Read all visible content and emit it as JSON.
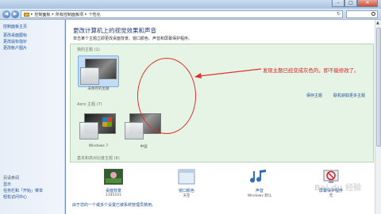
{
  "window": {
    "minimize_glyph": "–",
    "maximize_glyph": "□",
    "close_glyph": "✕"
  },
  "address": {
    "back_glyph": "◀",
    "forward_glyph": "▶",
    "separator": "▸",
    "crumbs": [
      "控制面板",
      "所有控制面板项",
      "个性化"
    ],
    "refresh_glyph": "↻",
    "search_placeholder": ""
  },
  "sidebar": {
    "home": "控制面板主页",
    "links": [
      "更改桌面图标",
      "更改鼠标指针",
      "更改帐户图片"
    ],
    "see_also_title": "另请参阅",
    "see_also": [
      "显示",
      "任务栏和「开始」菜单",
      "轻松访问中心"
    ]
  },
  "main": {
    "title": "更改计算机上的视觉效果和声音",
    "description": "单击某个主题立即更改桌面背景、窗口颜色、声音和屏幕保护程序。",
    "my_themes_label": "我的主题 (1)",
    "unsaved_theme_caption": "未保存的主题",
    "save_theme_link": "保存主题",
    "get_more_themes_link": "联机获取更多主题",
    "aero_label": "Aero 主题 (7)",
    "aero_themes": [
      "Windows 7",
      "中国"
    ],
    "basic_label": "基本和高对比度主题 (6)",
    "annotation": "发现主题已经变成灰色的，即不能修改了。"
  },
  "bottom": {
    "items": [
      {
        "label": "桌面背景",
        "sub": "1345101"
      },
      {
        "label": "窗口颜色",
        "sub": "天空"
      },
      {
        "label": "声音",
        "sub": "Windows 默认"
      },
      {
        "label": "屏幕保护程序",
        "sub": "无"
      }
    ],
    "tip": "由于您的一个或多个设置已被系统管理员禁用。"
  },
  "watermark": "Bai du 经验",
  "colors": {
    "annotation_red": "#d92020",
    "link_blue": "#1a4f96",
    "panel_green": "#e6f4e6"
  }
}
